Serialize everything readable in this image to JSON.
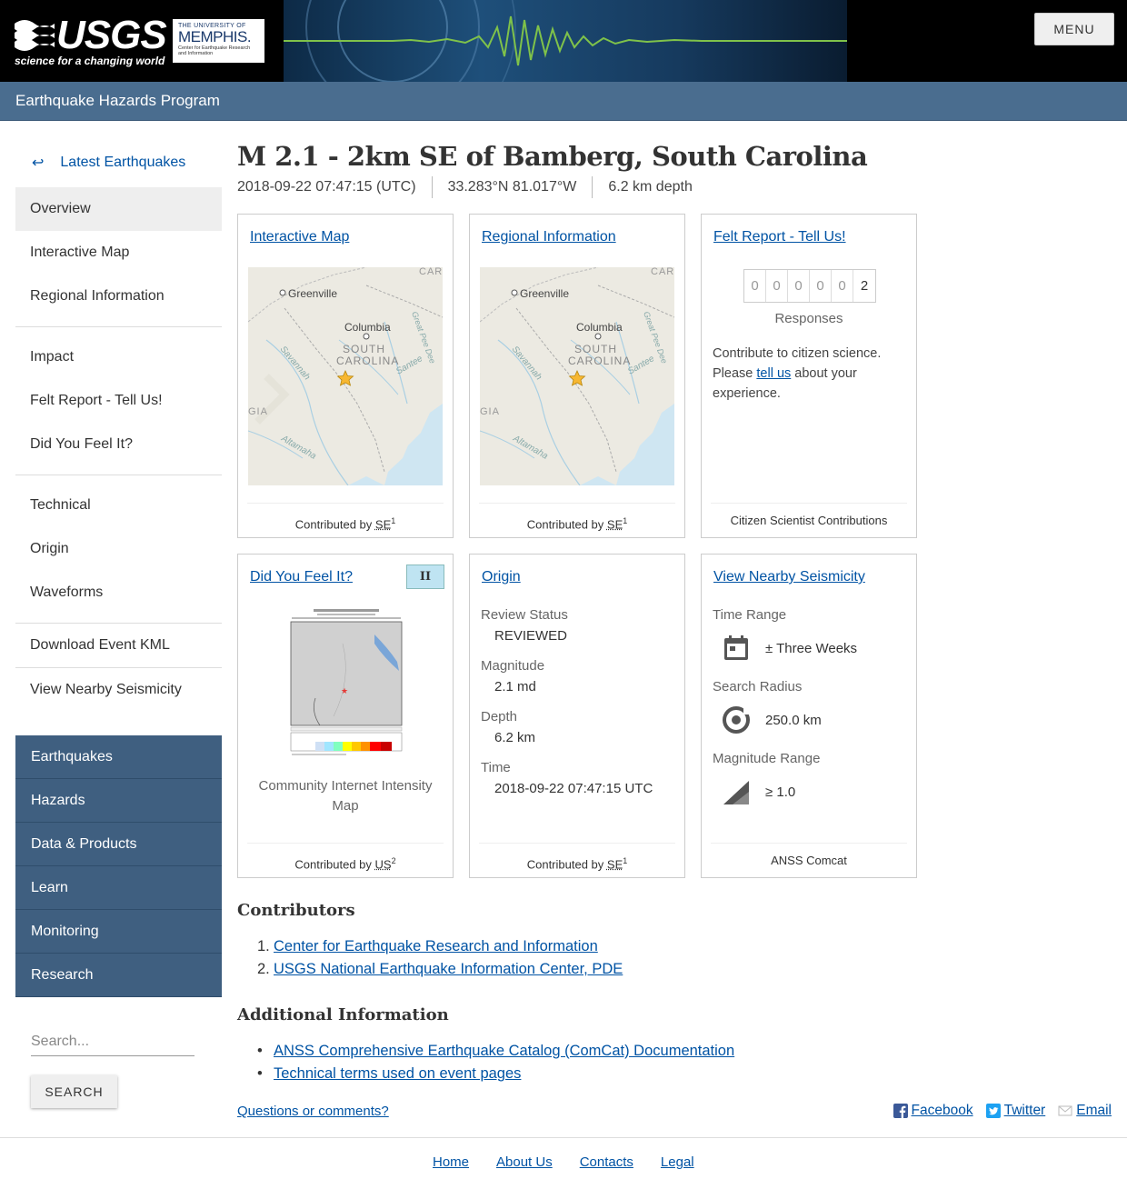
{
  "header": {
    "usgs_word": "USGS",
    "usgs_tag": "science for a changing world",
    "partner_line1": "THE UNIVERSITY OF",
    "partner_line2": "MEMPHIS.",
    "partner_line3": "Center for Earthquake Research and Information",
    "menu_label": "MENU",
    "program": "Earthquake Hazards Program"
  },
  "sidebar": {
    "back_label": "Latest Earthquakes",
    "group1": [
      "Overview",
      "Interactive Map",
      "Regional Information"
    ],
    "group2": [
      "Impact",
      "Felt Report - Tell Us!",
      "Did You Feel It?"
    ],
    "group3": [
      "Technical",
      "Origin",
      "Waveforms"
    ],
    "group4": [
      "Download Event KML"
    ],
    "group5": [
      "View Nearby Seismicity"
    ],
    "active": "Overview"
  },
  "site_nav": [
    "Earthquakes",
    "Hazards",
    "Data & Products",
    "Learn",
    "Monitoring",
    "Research"
  ],
  "search": {
    "placeholder": "Search...",
    "button": "SEARCH"
  },
  "event": {
    "title": "M 2.1 - 2km SE of Bamberg, South Carolina",
    "time": "2018-09-22 07:47:15 (UTC)",
    "location": "33.283°N 81.017°W",
    "depth": "6.2 km depth"
  },
  "cards": {
    "map": {
      "title": "Interactive Map",
      "footer_prefix": "Contributed by",
      "footer_net": "SE",
      "footer_ref": "1",
      "labels": {
        "greenville": "Greenville",
        "columbia": "Columbia",
        "state1": "SOUTH",
        "state2": "CAROLINA",
        "savannah": "Savannah",
        "santee": "Santee",
        "peedee": "Great Pee Dee",
        "altamaha": "Altamaha",
        "car": "CAR",
        "gia": "GIA"
      }
    },
    "regional": {
      "title": "Regional Information",
      "footer_prefix": "Contributed by",
      "footer_net": "SE",
      "footer_ref": "1"
    },
    "felt": {
      "title": "Felt Report - Tell Us!",
      "digits": [
        "0",
        "0",
        "0",
        "0",
        "0",
        "2"
      ],
      "responses_label": "Responses",
      "text_before": "Contribute to citizen science. Please",
      "link": "tell us",
      "text_after": "about your experience.",
      "footer": "Citizen Scientist Contributions"
    },
    "dyfi": {
      "title": "Did You Feel It?",
      "mmi": "II",
      "caption": "Community Internet Intensity Map",
      "footer_prefix": "Contributed by",
      "footer_net": "US",
      "footer_ref": "2"
    },
    "origin": {
      "title": "Origin",
      "review_label": "Review Status",
      "review_value": "REVIEWED",
      "mag_label": "Magnitude",
      "mag_value": "2.1 md",
      "depth_label": "Depth",
      "depth_value": "6.2 km",
      "time_label": "Time",
      "time_value": "2018-09-22 07:47:15 UTC",
      "footer_prefix": "Contributed by",
      "footer_net": "SE",
      "footer_ref": "1"
    },
    "seismicity": {
      "title": "View Nearby Seismicity",
      "time_label": "Time Range",
      "time_value": "± Three Weeks",
      "radius_label": "Search Radius",
      "radius_value": "250.0 km",
      "mag_label": "Magnitude Range",
      "mag_value": "≥ 1.0",
      "footer": "ANSS Comcat"
    }
  },
  "contributors": {
    "heading": "Contributors",
    "items": [
      "Center for Earthquake Research and Information",
      "USGS National Earthquake Information Center, PDE"
    ]
  },
  "additional": {
    "heading": "Additional Information",
    "items": [
      "ANSS Comprehensive Earthquake Catalog (ComCat) Documentation",
      "Technical terms used on event pages"
    ]
  },
  "footer": {
    "questions": "Questions or comments?",
    "social": [
      "Facebook",
      "Twitter",
      "Email"
    ],
    "links": [
      "Home",
      "About Us",
      "Contacts",
      "Legal"
    ]
  },
  "colors": {
    "program_bar": "#4a6d8f",
    "site_nav": "#3f5f80",
    "link": "#0053a4",
    "mmi": "#bfe4f2"
  }
}
